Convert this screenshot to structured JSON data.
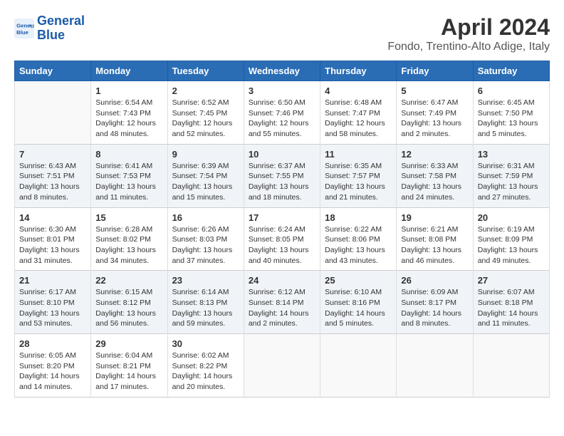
{
  "logo": {
    "line1": "General",
    "line2": "Blue"
  },
  "title": "April 2024",
  "subtitle": "Fondo, Trentino-Alto Adige, Italy",
  "header_days": [
    "Sunday",
    "Monday",
    "Tuesday",
    "Wednesday",
    "Thursday",
    "Friday",
    "Saturday"
  ],
  "weeks": [
    [
      {
        "day": "",
        "info": ""
      },
      {
        "day": "1",
        "info": "Sunrise: 6:54 AM\nSunset: 7:43 PM\nDaylight: 12 hours\nand 48 minutes."
      },
      {
        "day": "2",
        "info": "Sunrise: 6:52 AM\nSunset: 7:45 PM\nDaylight: 12 hours\nand 52 minutes."
      },
      {
        "day": "3",
        "info": "Sunrise: 6:50 AM\nSunset: 7:46 PM\nDaylight: 12 hours\nand 55 minutes."
      },
      {
        "day": "4",
        "info": "Sunrise: 6:48 AM\nSunset: 7:47 PM\nDaylight: 12 hours\nand 58 minutes."
      },
      {
        "day": "5",
        "info": "Sunrise: 6:47 AM\nSunset: 7:49 PM\nDaylight: 13 hours\nand 2 minutes."
      },
      {
        "day": "6",
        "info": "Sunrise: 6:45 AM\nSunset: 7:50 PM\nDaylight: 13 hours\nand 5 minutes."
      }
    ],
    [
      {
        "day": "7",
        "info": "Sunrise: 6:43 AM\nSunset: 7:51 PM\nDaylight: 13 hours\nand 8 minutes."
      },
      {
        "day": "8",
        "info": "Sunrise: 6:41 AM\nSunset: 7:53 PM\nDaylight: 13 hours\nand 11 minutes."
      },
      {
        "day": "9",
        "info": "Sunrise: 6:39 AM\nSunset: 7:54 PM\nDaylight: 13 hours\nand 15 minutes."
      },
      {
        "day": "10",
        "info": "Sunrise: 6:37 AM\nSunset: 7:55 PM\nDaylight: 13 hours\nand 18 minutes."
      },
      {
        "day": "11",
        "info": "Sunrise: 6:35 AM\nSunset: 7:57 PM\nDaylight: 13 hours\nand 21 minutes."
      },
      {
        "day": "12",
        "info": "Sunrise: 6:33 AM\nSunset: 7:58 PM\nDaylight: 13 hours\nand 24 minutes."
      },
      {
        "day": "13",
        "info": "Sunrise: 6:31 AM\nSunset: 7:59 PM\nDaylight: 13 hours\nand 27 minutes."
      }
    ],
    [
      {
        "day": "14",
        "info": "Sunrise: 6:30 AM\nSunset: 8:01 PM\nDaylight: 13 hours\nand 31 minutes."
      },
      {
        "day": "15",
        "info": "Sunrise: 6:28 AM\nSunset: 8:02 PM\nDaylight: 13 hours\nand 34 minutes."
      },
      {
        "day": "16",
        "info": "Sunrise: 6:26 AM\nSunset: 8:03 PM\nDaylight: 13 hours\nand 37 minutes."
      },
      {
        "day": "17",
        "info": "Sunrise: 6:24 AM\nSunset: 8:05 PM\nDaylight: 13 hours\nand 40 minutes."
      },
      {
        "day": "18",
        "info": "Sunrise: 6:22 AM\nSunset: 8:06 PM\nDaylight: 13 hours\nand 43 minutes."
      },
      {
        "day": "19",
        "info": "Sunrise: 6:21 AM\nSunset: 8:08 PM\nDaylight: 13 hours\nand 46 minutes."
      },
      {
        "day": "20",
        "info": "Sunrise: 6:19 AM\nSunset: 8:09 PM\nDaylight: 13 hours\nand 49 minutes."
      }
    ],
    [
      {
        "day": "21",
        "info": "Sunrise: 6:17 AM\nSunset: 8:10 PM\nDaylight: 13 hours\nand 53 minutes."
      },
      {
        "day": "22",
        "info": "Sunrise: 6:15 AM\nSunset: 8:12 PM\nDaylight: 13 hours\nand 56 minutes."
      },
      {
        "day": "23",
        "info": "Sunrise: 6:14 AM\nSunset: 8:13 PM\nDaylight: 13 hours\nand 59 minutes."
      },
      {
        "day": "24",
        "info": "Sunrise: 6:12 AM\nSunset: 8:14 PM\nDaylight: 14 hours\nand 2 minutes."
      },
      {
        "day": "25",
        "info": "Sunrise: 6:10 AM\nSunset: 8:16 PM\nDaylight: 14 hours\nand 5 minutes."
      },
      {
        "day": "26",
        "info": "Sunrise: 6:09 AM\nSunset: 8:17 PM\nDaylight: 14 hours\nand 8 minutes."
      },
      {
        "day": "27",
        "info": "Sunrise: 6:07 AM\nSunset: 8:18 PM\nDaylight: 14 hours\nand 11 minutes."
      }
    ],
    [
      {
        "day": "28",
        "info": "Sunrise: 6:05 AM\nSunset: 8:20 PM\nDaylight: 14 hours\nand 14 minutes."
      },
      {
        "day": "29",
        "info": "Sunrise: 6:04 AM\nSunset: 8:21 PM\nDaylight: 14 hours\nand 17 minutes."
      },
      {
        "day": "30",
        "info": "Sunrise: 6:02 AM\nSunset: 8:22 PM\nDaylight: 14 hours\nand 20 minutes."
      },
      {
        "day": "",
        "info": ""
      },
      {
        "day": "",
        "info": ""
      },
      {
        "day": "",
        "info": ""
      },
      {
        "day": "",
        "info": ""
      }
    ]
  ]
}
